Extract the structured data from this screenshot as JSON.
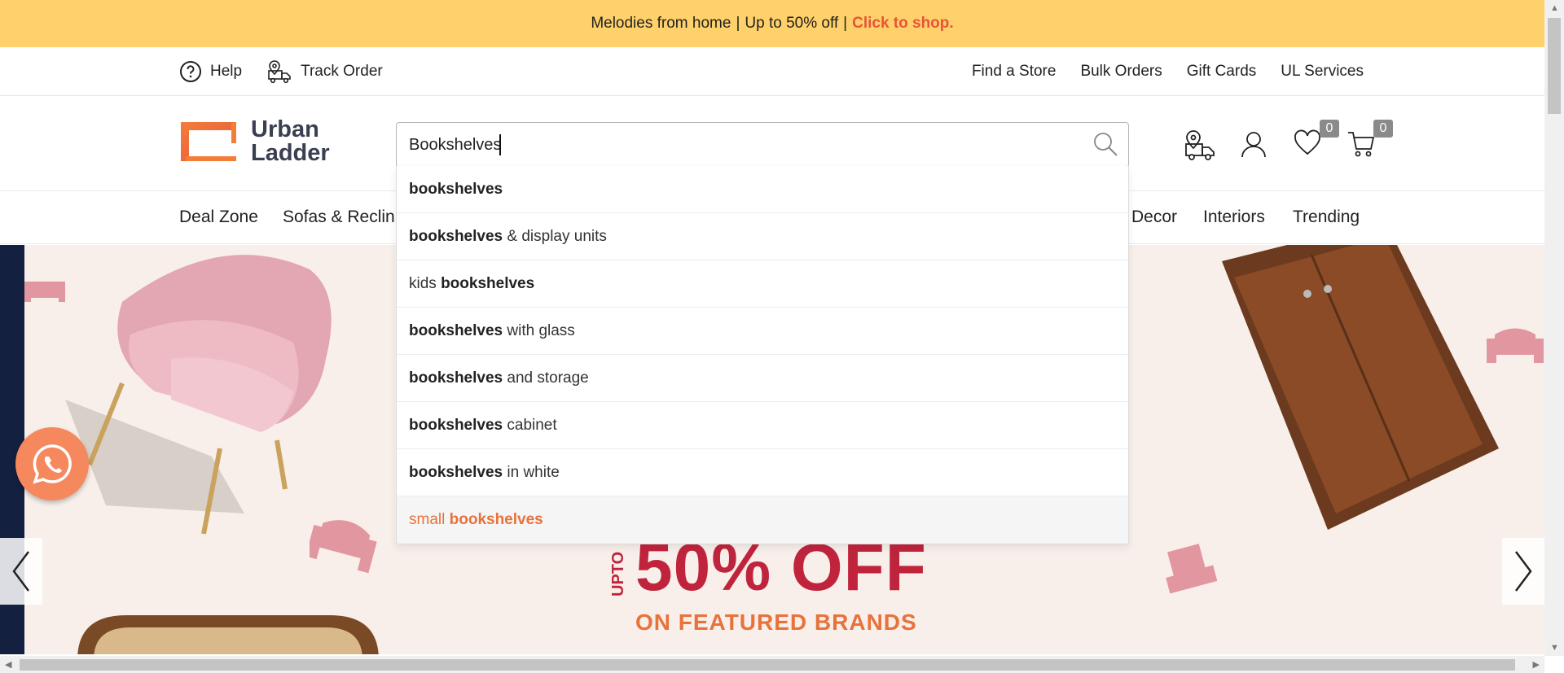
{
  "promo": {
    "text": "Melodies from home",
    "separator": "|",
    "offer": "Up to 50% off",
    "cta": "Click to shop."
  },
  "util": {
    "help": "Help",
    "track_order": "Track Order",
    "links": [
      "Find a Store",
      "Bulk Orders",
      "Gift Cards",
      "UL Services"
    ]
  },
  "logo": {
    "line1": "Urban",
    "line2": "Ladder"
  },
  "search": {
    "value": "Bookshelves"
  },
  "header_badges": {
    "wishlist": "0",
    "cart": "0"
  },
  "nav": {
    "items": [
      "Deal Zone",
      "Sofas & Reclin",
      "Decor",
      "Interiors",
      "Trending"
    ]
  },
  "suggestions": [
    {
      "pre": "",
      "bold": "bookshelves",
      "post": ""
    },
    {
      "pre": "",
      "bold": "bookshelves",
      "post": " & display units"
    },
    {
      "pre": "kids ",
      "bold": "bookshelves",
      "post": ""
    },
    {
      "pre": "",
      "bold": "bookshelves",
      "post": " with glass"
    },
    {
      "pre": "",
      "bold": "bookshelves",
      "post": " and storage"
    },
    {
      "pre": "",
      "bold": "bookshelves",
      "post": " cabinet"
    },
    {
      "pre": "",
      "bold": "bookshelves",
      "post": " in white"
    },
    {
      "pre": "small ",
      "bold": "bookshelves",
      "post": ""
    }
  ],
  "hero": {
    "upto": "UPTO",
    "headline": "50% OFF",
    "sub": "ON FEATURED BRANDS"
  },
  "colors": {
    "promo_bg": "#ffd16a",
    "accent": "#e8723a",
    "headline": "#c0243d"
  }
}
